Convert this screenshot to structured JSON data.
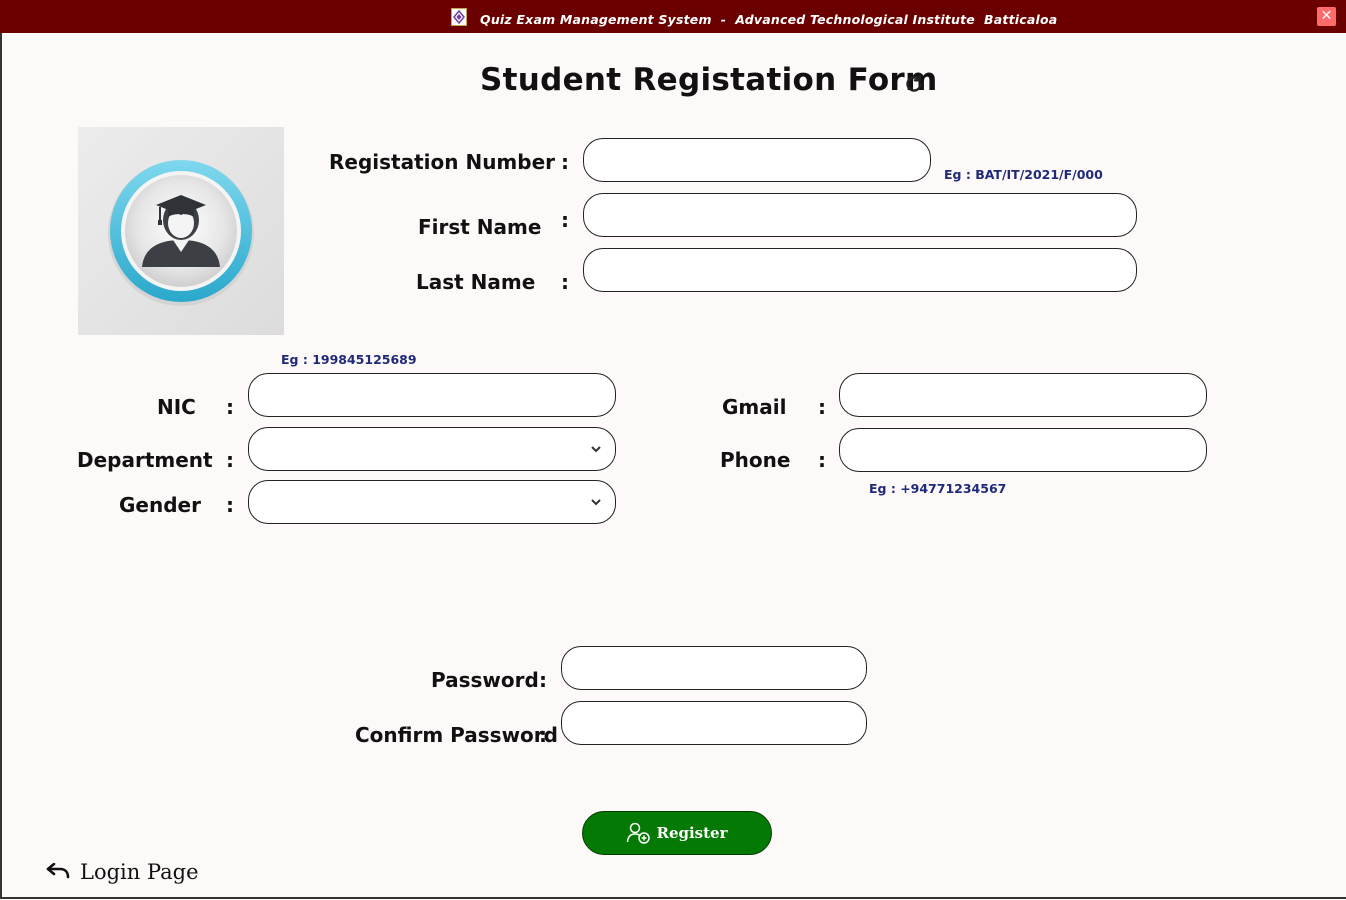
{
  "window": {
    "title": "Quiz Exam Management System  -  Advanced Technological Institute  Batticaloa",
    "close_label": "✕"
  },
  "form": {
    "heading": "Student Registation Form",
    "registration_number": {
      "label": "Registation Number",
      "colon": ":",
      "value": "",
      "hint": "Eg : BAT/IT/2021/F/000"
    },
    "first_name": {
      "label": "First Name",
      "colon": ":",
      "value": ""
    },
    "last_name": {
      "label": "Last Name",
      "colon": ":",
      "value": ""
    },
    "nic": {
      "label": "NIC",
      "colon": ":",
      "value": "",
      "hint": "Eg : 199845125689"
    },
    "department": {
      "label": "Department",
      "colon": ":",
      "value": ""
    },
    "gender": {
      "label": "Gender",
      "colon": ":",
      "value": ""
    },
    "gmail": {
      "label": "Gmail",
      "colon": ":",
      "value": ""
    },
    "phone": {
      "label": "Phone",
      "colon": ":",
      "value": "",
      "hint": "Eg : +94771234567"
    },
    "password": {
      "label": "Password",
      "colon": ":",
      "value": ""
    },
    "confirm_password": {
      "label": "Confirm Password",
      "colon": ":",
      "value": ""
    },
    "register_label": "Register",
    "login_label": "Login Page"
  },
  "icons": [
    "app-logo-icon",
    "close-icon",
    "refresh-icon",
    "student-graduate-icon",
    "chevron-down-icon",
    "add-user-icon",
    "undo-arrow-icon"
  ],
  "colors": {
    "titlebar": "#6b0000",
    "register_button": "#047a04",
    "hint_text": "#1f2a7a",
    "background": "#fdf9f9"
  }
}
